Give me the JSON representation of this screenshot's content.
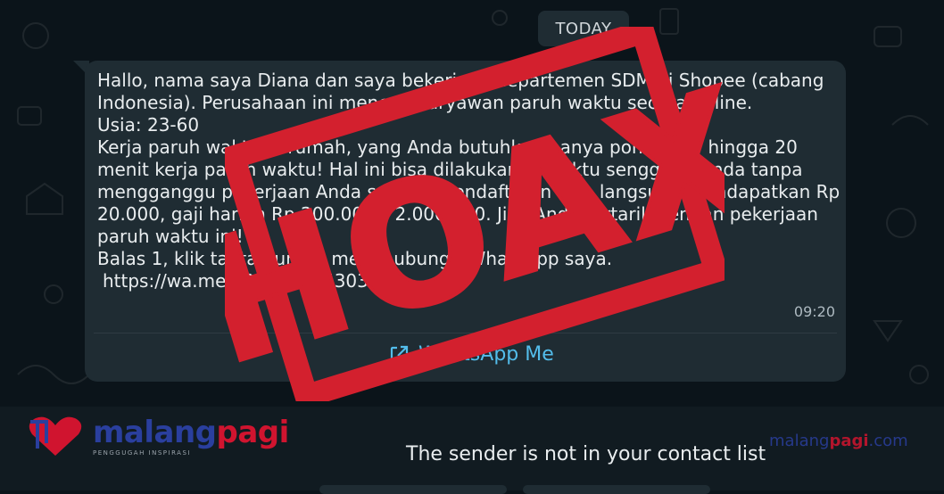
{
  "date_label": "TODAY",
  "message": {
    "lines": [
      "Hallo, nama saya Diana dan saya bekerja di departemen SDM di Shopee (cabang",
      "Indonesia). Perusahaan ini mencari karyawan paruh waktu secara online.",
      "Usia: 23-60",
      "Kerja paruh waktu di rumah, yang Anda butuhkan hanya ponsel. 10 hingga 20",
      "menit kerja paruh waktu! Hal ini bisa dilakukan di waktu senggang Anda tanpa",
      "mengganggu pekerjaan Anda saat ini. Pendaftaran bisa langsung mendapatkan Rp",
      "20.000, gaji harian Rp 200.000 – 2.000.000. Jika Anda tertarik dengan pekerjaan",
      "paruh waktu ini!",
      "Balas 1, klik tautan untuk menghubungi! WhatsApp saya."
    ],
    "link": "https://wa.me/6282180953034",
    "time": "09:20",
    "action_label": "WhatsApp Me"
  },
  "stamp_text": "HOAX",
  "notice": "The sender is not in your contact list",
  "brand": {
    "name_part1": "malang",
    "name_part2": "pagi",
    "tagline": "PENGGUGAH INSPIRASI",
    "url_part1": "malang",
    "url_part2": "pagi",
    "url_part3": ".com"
  },
  "colors": {
    "background": "#0b141a",
    "bubble": "#1f2c33",
    "link_blue": "#53bdeb",
    "stamp_red": "#d3202e"
  }
}
